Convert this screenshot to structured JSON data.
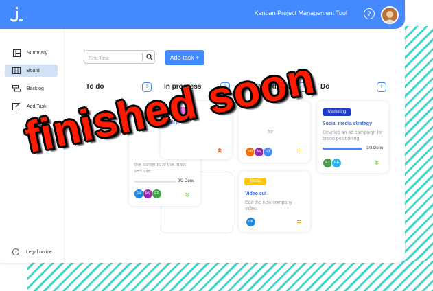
{
  "header": {
    "title": "Kanban Project Management Tool",
    "help": "?"
  },
  "sidebar": {
    "items": [
      {
        "label": "Summary",
        "icon": "summary-icon"
      },
      {
        "label": "Board",
        "icon": "board-icon",
        "active": true
      },
      {
        "label": "Backlog",
        "icon": "backlog-icon"
      },
      {
        "label": "Add Task",
        "icon": "add-task-icon"
      }
    ],
    "legal": "Legal notice"
  },
  "toolbar": {
    "search_placeholder": "Find Task",
    "add_task_label": "Add task +"
  },
  "columns": [
    {
      "title": "To do",
      "plus": "+"
    },
    {
      "title": "In progress",
      "plus": "+"
    },
    {
      "title": "Await feedback",
      "plus": "+"
    },
    {
      "title": "Do",
      "plus": "+"
    }
  ],
  "cards": {
    "sales": {
      "badge": "Sales",
      "badge_color": "#ff7ae0",
      "title": "Call a",
      "priority_color": "#ff3d00"
    },
    "website": {
      "desc": "the contents of the main website.",
      "progress_text": "0/2 Done",
      "progress": 0,
      "users": [
        "SM",
        "MV",
        "EF"
      ],
      "user_colors": [
        "#1e88e5",
        "#9c27b0",
        "#43a047"
      ],
      "priority_color": "#7ed957"
    },
    "feedback": {
      "desc_fragment": "for",
      "users": [
        "MB",
        "AM",
        "+3"
      ],
      "user_colors": [
        "#ff6d00",
        "#9c27b0",
        "#4589ff"
      ],
      "priority_color": "#ffa800"
    },
    "media": {
      "badge": "Media",
      "badge_color": "#ffc701",
      "title": "Video cut",
      "desc": "Edit the new company video.",
      "users": [
        "HK"
      ],
      "user_colors": [
        "#1e88e5"
      ],
      "priority_color": "#ffa800"
    },
    "social": {
      "badge": "Marketing",
      "badge_color": "#1f3cc7",
      "title": "Social media strategy",
      "desc": "Develop an ad campaign for brand positioning",
      "progress_text": "3/3 Done",
      "progress": 1,
      "users": [
        "EZ",
        "RE"
      ],
      "user_colors": [
        "#43a047",
        "#29b6f6"
      ],
      "priority_color": "#7ed957"
    }
  },
  "overlay": {
    "text": "finished soon",
    "color": "#ff1a00"
  }
}
